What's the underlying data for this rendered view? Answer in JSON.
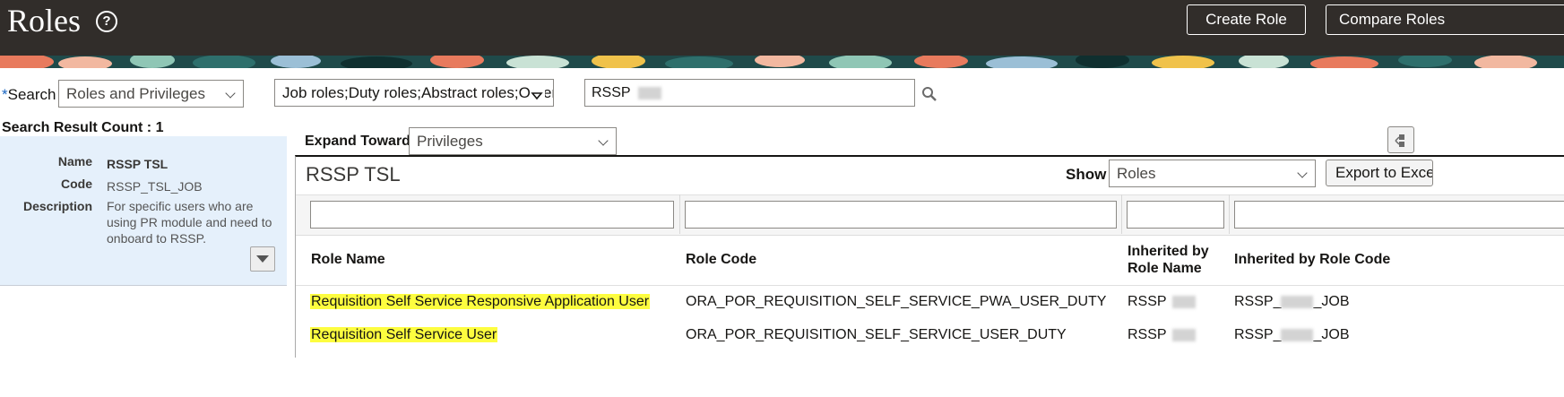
{
  "header": {
    "title": "Roles",
    "create_role_label": "Create Role",
    "compare_roles_label": "Compare Roles"
  },
  "search": {
    "label": "Search",
    "required_marker": "*",
    "type_value": "Roles and Privileges",
    "role_types_value": "Job roles;Duty roles;Abstract roles;Other",
    "query_value": "RSSP"
  },
  "result_count_label": "Search Result Count : 1",
  "detail": {
    "name_label": "Name",
    "name_value": "RSSP TSL",
    "code_label": "Code",
    "code_value": "RSSP_TSL_JOB",
    "description_label": "Description",
    "description_value": "For specific users who are using PR module and need to onboard to RSSP."
  },
  "expand": {
    "label": "Expand Toward",
    "value": "Privileges"
  },
  "results": {
    "title": "RSSP TSL",
    "show_label": "Show",
    "show_value": "Roles",
    "export_label": "Export to Excel",
    "columns": {
      "role_name": "Role Name",
      "role_code": "Role Code",
      "inherited_name": "Inherited by Role Name",
      "inherited_code": "Inherited by Role Code"
    },
    "rows": [
      {
        "role_name": "Requisition Self Service Responsive Application User",
        "role_code": "ORA_POR_REQUISITION_SELF_SERVICE_PWA_USER_DUTY",
        "inherited_name_prefix": "RSSP",
        "inherited_code_prefix": "RSSP_",
        "inherited_code_suffix": "_JOB"
      },
      {
        "role_name": "Requisition Self Service User",
        "role_code": "ORA_POR_REQUISITION_SELF_SERVICE_USER_DUTY",
        "inherited_name_prefix": "RSSP",
        "inherited_code_prefix": "RSSP_",
        "inherited_code_suffix": "_JOB"
      }
    ]
  },
  "colors": {
    "header_bg": "#312d2a",
    "highlight": "#fdfd3f",
    "detail_bg": "#e5f0fb",
    "required": "#1a66c2"
  }
}
